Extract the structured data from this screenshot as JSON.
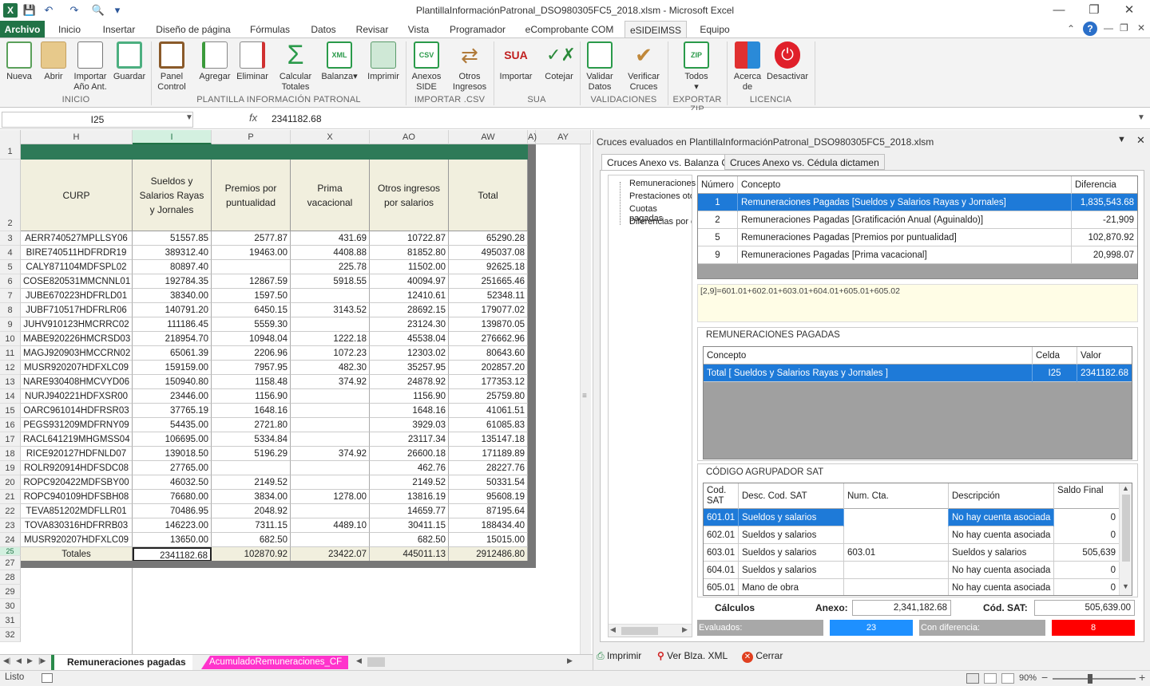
{
  "window": {
    "title": "PlantillaInformaciónPatronal_DSO980305FC5_2018.xlsm - Microsoft Excel"
  },
  "tabs": [
    "Archivo",
    "Inicio",
    "Insertar",
    "Diseño de página",
    "Fórmulas",
    "Datos",
    "Revisar",
    "Vista",
    "Programador",
    "eComprobante COM",
    "eSIDEIMSS",
    "Equipo"
  ],
  "ribbon": {
    "buttons": [
      {
        "l1": "Nueva",
        "l2": ""
      },
      {
        "l1": "Abrir",
        "l2": ""
      },
      {
        "l1": "Importar",
        "l2": "Año Ant."
      },
      {
        "l1": "Guardar",
        "l2": ""
      },
      {
        "l1": "Panel",
        "l2": "Control"
      },
      {
        "l1": "Agregar",
        "l2": ""
      },
      {
        "l1": "Eliminar",
        "l2": ""
      },
      {
        "l1": "Calcular",
        "l2": "Totales"
      },
      {
        "l1": "Balanza",
        "l2": ""
      },
      {
        "l1": "Imprimir",
        "l2": ""
      },
      {
        "l1": "Anexos",
        "l2": "SIDE"
      },
      {
        "l1": "Otros",
        "l2": "Ingresos"
      },
      {
        "l1": "Importar",
        "l2": ""
      },
      {
        "l1": "Cotejar",
        "l2": ""
      },
      {
        "l1": "Validar",
        "l2": "Datos"
      },
      {
        "l1": "Verificar",
        "l2": "Cruces"
      },
      {
        "l1": "Todos",
        "l2": ""
      },
      {
        "l1": "Acerca",
        "l2": "de"
      },
      {
        "l1": "Desactivar",
        "l2": ""
      }
    ],
    "groups": [
      "INICIO",
      "PLANTILLA INFORMACIÓN PATRONAL",
      "IMPORTAR .CSV",
      "SUA",
      "VALIDACIONES",
      "EXPORTAR ZIP",
      "LICENCIA"
    ]
  },
  "formula_bar": {
    "name_box": "I25",
    "fx": "fx",
    "value": "2341182.68"
  },
  "sheet": {
    "columns": [
      "H",
      "I",
      "P",
      "X",
      "AO",
      "AW",
      "A)",
      "AY"
    ],
    "headers": {
      "curp": "CURP",
      "sueldos": "Sueldos y Salarios Rayas y Jornales",
      "premios": "Premios por puntualidad",
      "prima": "Prima vacacional",
      "otros": "Otros ingresos por salarios",
      "total": "Total"
    },
    "row_numbers": [
      "1",
      "2",
      "3",
      "4",
      "5",
      "6",
      "7",
      "8",
      "9",
      "10",
      "11",
      "12",
      "13",
      "14",
      "15",
      "16",
      "17",
      "18",
      "19",
      "20",
      "21",
      "22",
      "23",
      "24",
      "25",
      "27",
      "28",
      "29",
      "30",
      "31",
      "32"
    ],
    "rows": [
      [
        "AERR740527MPLLSY06",
        "51557.85",
        "2577.87",
        "431.69",
        "10722.87",
        "65290.28"
      ],
      [
        "BIRE740511HDFRDR19",
        "389312.40",
        "19463.00",
        "4408.88",
        "81852.80",
        "495037.08"
      ],
      [
        "CALY871104MDFSPL02",
        "80897.40",
        "",
        "225.78",
        "11502.00",
        "92625.18"
      ],
      [
        "COSE820531MMCNNL01",
        "192784.35",
        "12867.59",
        "5918.55",
        "40094.97",
        "251665.46"
      ],
      [
        "JUBE670223HDFRLD01",
        "38340.00",
        "1597.50",
        "",
        "12410.61",
        "52348.11"
      ],
      [
        "JUBF710517HDFRLR06",
        "140791.20",
        "6450.15",
        "3143.52",
        "28692.15",
        "179077.02"
      ],
      [
        "JUHV910123HMCRRC02",
        "111186.45",
        "5559.30",
        "",
        "23124.30",
        "139870.05"
      ],
      [
        "MABE920226HMCRSD03",
        "218954.70",
        "10948.04",
        "1222.18",
        "45538.04",
        "276662.96"
      ],
      [
        "MAGJ920903HMCCRN02",
        "65061.39",
        "2206.96",
        "1072.23",
        "12303.02",
        "80643.60"
      ],
      [
        "MUSR920207HDFXLC09",
        "159159.00",
        "7957.95",
        "482.30",
        "35257.95",
        "202857.20"
      ],
      [
        "NARE930408HMCVYD06",
        "150940.80",
        "1158.48",
        "374.92",
        "24878.92",
        "177353.12"
      ],
      [
        "NURJ940221HDFXSR00",
        "23446.00",
        "1156.90",
        "",
        "1156.90",
        "25759.80"
      ],
      [
        "OARC961014HDFRSR03",
        "37765.19",
        "1648.16",
        "",
        "1648.16",
        "41061.51"
      ],
      [
        "PEGS931209MDFRNY09",
        "54435.00",
        "2721.80",
        "",
        "3929.03",
        "61085.83"
      ],
      [
        "RACL641219MHGMSS04",
        "106695.00",
        "5334.84",
        "",
        "23117.34",
        "135147.18"
      ],
      [
        "RICE920127HDFNLD07",
        "139018.50",
        "5196.29",
        "374.92",
        "26600.18",
        "171189.89"
      ],
      [
        "ROLR920914HDFSDC08",
        "27765.00",
        "",
        "",
        "462.76",
        "28227.76"
      ],
      [
        "ROPC920422MDFSBY00",
        "46032.50",
        "2149.52",
        "",
        "2149.52",
        "50331.54"
      ],
      [
        "ROPC940109HDFSBH08",
        "76680.00",
        "3834.00",
        "1278.00",
        "13816.19",
        "95608.19"
      ],
      [
        "TEVA851202MDFLLR01",
        "70486.95",
        "2048.92",
        "",
        "14659.77",
        "87195.64"
      ],
      [
        "TOVA830316HDFRRB03",
        "146223.00",
        "7311.15",
        "4489.10",
        "30411.15",
        "188434.40"
      ],
      [
        "MUSR920207HDFXLC09",
        "13650.00",
        "682.50",
        "",
        "682.50",
        "15015.00"
      ]
    ],
    "totals": [
      "Totales",
      "2341182.68",
      "102870.92",
      "23422.07",
      "445011.13",
      "2912486.80"
    ],
    "sheet_tabs": [
      "Remuneraciones pagadas",
      "AcumuladoRemuneraciones_CF"
    ]
  },
  "panel": {
    "title": "Cruces evaluados en PlantillaInformaciónPatronal_DSO980305FC5_2018.xlsm",
    "tabs": [
      "Cruces Anexo vs. Balanza CE",
      "Cruces Anexo vs. Cédula dictamen"
    ],
    "tree": [
      "Remuneraciones",
      "Prestaciones oto",
      "Cuotas pagadas",
      "Diferencias por c"
    ],
    "cross_table": {
      "headers": [
        "Número",
        "Concepto",
        "Diferencia"
      ],
      "rows": [
        [
          "1",
          "Remuneraciones Pagadas [Sueldos y Salarios Rayas y Jornales]",
          "1,835,543.68"
        ],
        [
          "2",
          "Remuneraciones Pagadas [Gratificación Anual (Aguinaldo)]",
          "-21,909"
        ],
        [
          "5",
          "Remuneraciones Pagadas [Premios por puntualidad]",
          "102,870.92"
        ],
        [
          "9",
          "Remuneraciones Pagadas [Prima vacacional]",
          "20,998.07"
        ]
      ]
    },
    "formula": "[2,9]=601.01+602.01+603.01+604.01+605.01+605.02",
    "remun": {
      "title": "REMUNERACIONES PAGADAS",
      "headers": [
        "Concepto",
        "Celda",
        "Valor"
      ],
      "row": [
        "Total [ Sueldos y Salarios Rayas y Jornales ]",
        "I25",
        "2341182.68"
      ]
    },
    "sat": {
      "title": "CÓDIGO AGRUPADOR SAT",
      "headers": [
        "Cod. SAT",
        "Desc. Cod. SAT",
        "Num. Cta.",
        "Descripción",
        "Saldo Final"
      ],
      "rows": [
        [
          "601.01",
          "Sueldos y salarios",
          "",
          "No hay cuenta asociada",
          "0"
        ],
        [
          "602.01",
          "Sueldos y salarios",
          "",
          "No hay cuenta asociada",
          "0"
        ],
        [
          "603.01",
          "Sueldos y salarios",
          "603.01",
          "Sueldos y salarios",
          "505,639"
        ],
        [
          "604.01",
          "Sueldos y salarios",
          "",
          "No hay cuenta asociada",
          "0"
        ],
        [
          "605.01",
          "Mano de obra",
          "",
          "No hay cuenta asociada",
          "0"
        ]
      ]
    },
    "calc": {
      "label": "Cálculos",
      "anexo_label": "Anexo:",
      "anexo_value": "2,341,182.68",
      "sat_label": "Cód. SAT:",
      "sat_value": "505,639.00"
    },
    "stats": {
      "evaluados_label": "Evaluados:",
      "evaluados": "23",
      "diferencia_label": "Con diferencia:",
      "diferencia": "8"
    },
    "buttons": [
      "Imprimir",
      "Ver Blza. XML",
      "Cerrar"
    ]
  },
  "status": {
    "ready": "Listo",
    "zoom": "90%"
  },
  "colors": {
    "excel_green": "#217346",
    "selection_blue": "#1e7ad8",
    "evaluados_blue": "#1e90ff",
    "diferencia_red": "#ff0000",
    "header_fill": "#f1efde",
    "band_green": "#2e7a58"
  }
}
